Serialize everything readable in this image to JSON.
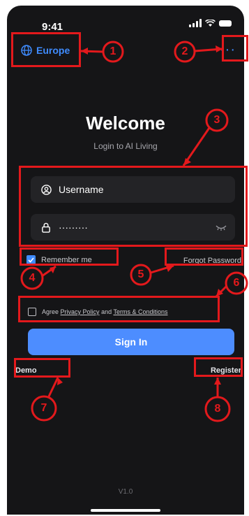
{
  "status_bar": {
    "time": "9:41"
  },
  "header": {
    "region_label": "Europe",
    "more_label": "···"
  },
  "welcome": {
    "title": "Welcome",
    "subtitle": "Login to AI Living"
  },
  "form": {
    "username_placeholder": "Username",
    "password_masked": "·········",
    "remember_label": "Remember me",
    "remember_checked": true,
    "forgot_label": "Forgot Password",
    "agree_prefix": "Agree",
    "privacy_link": "Privacy Policy",
    "agree_and": "and",
    "terms_link": "Terms & Conditions",
    "agree_checked": false,
    "signin_label": "Sign In"
  },
  "footer": {
    "demo_label": "Demo",
    "register_label": "Register",
    "version": "V1.0"
  },
  "colors": {
    "background": "#151517",
    "accent": "#4d8dff",
    "annotation": "#e3191c"
  },
  "annotations": [
    "1",
    "2",
    "3",
    "4",
    "5",
    "6",
    "7",
    "8"
  ]
}
